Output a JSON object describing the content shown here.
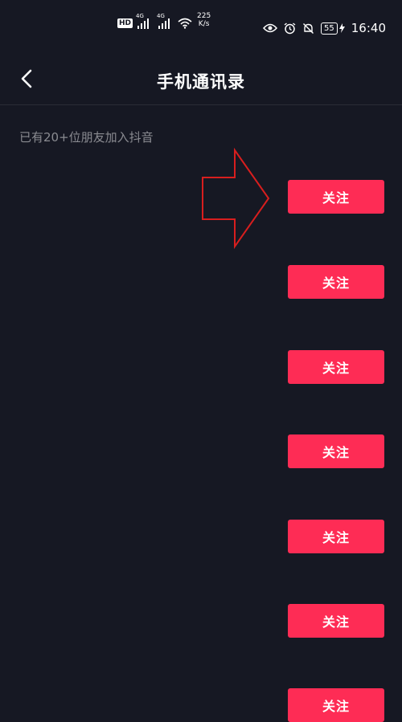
{
  "status_bar": {
    "hd": "HD",
    "network_1": "4G",
    "network_2": "4G",
    "speed_value": "225",
    "speed_unit": "K/s",
    "battery": "55",
    "time": "16:40"
  },
  "header": {
    "title": "手机通讯录"
  },
  "info": {
    "friend_count_text": "已有20+位朋友加入抖音"
  },
  "contacts": [
    {
      "follow_label": "关注"
    },
    {
      "follow_label": "关注"
    },
    {
      "follow_label": "关注"
    },
    {
      "follow_label": "关注"
    },
    {
      "follow_label": "关注"
    },
    {
      "follow_label": "关注"
    },
    {
      "follow_label": "关注"
    }
  ],
  "colors": {
    "background": "#161823",
    "accent": "#fe2c55",
    "annotation_arrow": "#d81e1e"
  }
}
